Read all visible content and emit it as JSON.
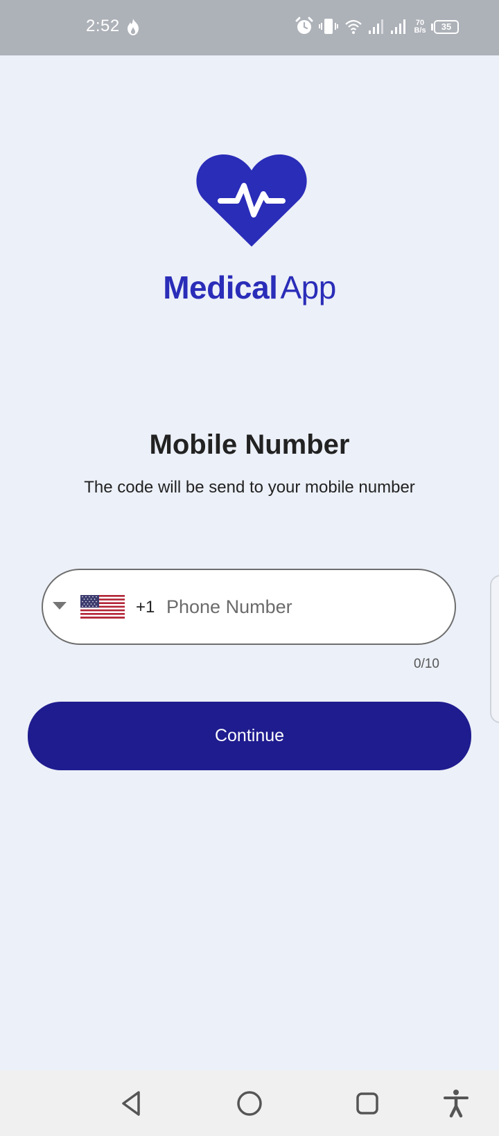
{
  "status_bar": {
    "time": "2:52",
    "net_speed_value": "70",
    "net_speed_unit": "B/s",
    "battery": "35",
    "icons": [
      "flame-icon",
      "alarm-icon",
      "vibrate-icon",
      "wifi-icon",
      "signal-icon",
      "signal-icon",
      "battery-icon"
    ]
  },
  "brand": {
    "name_bold": "Medical",
    "name_light": "App",
    "color": "#2A2DB8"
  },
  "header": {
    "title": "Mobile Number",
    "subtitle": "The code will be send to your mobile number"
  },
  "phone_field": {
    "country_flag": "us-flag-icon",
    "dial_code": "+1",
    "placeholder": "Phone Number",
    "value": "",
    "counter": "0/10"
  },
  "actions": {
    "continue_label": "Continue",
    "button_color": "#1F1C8F"
  },
  "nav_bar": {
    "buttons": [
      "back-icon",
      "home-icon",
      "recents-icon",
      "accessibility-icon"
    ]
  }
}
